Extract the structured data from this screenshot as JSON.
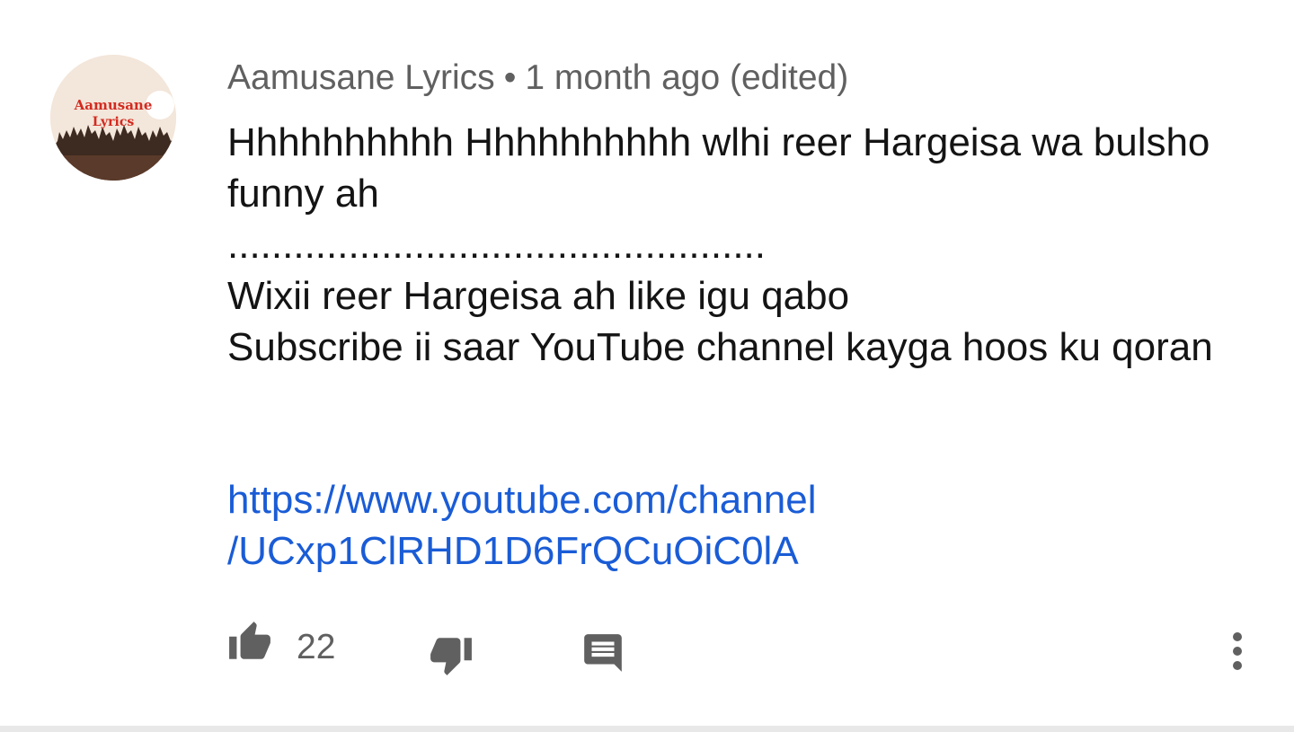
{
  "comment": {
    "avatar": {
      "text_line1": "Aamusane",
      "text_line2": "Lyrics",
      "accent_color": "#d42a1f"
    },
    "author": "Aamusane Lyrics",
    "separator": "•",
    "time": "1 month ago (edited)",
    "body": "Hhhhhhhhhh Hhhhhhhhhh wlhi reer Hargeisa wa bulsho funny ah\n.................................................\nWixii reer Hargeisa ah like igu qabo\nSubscribe ii saar YouTube channel kayga hoos ku qoran",
    "link_line1": "https://www.youtube.com/channel",
    "link_line2": "/UCxp1ClRHD1D6FrQCuOiC0lA",
    "link_color": "#1a5cd6"
  },
  "actions": {
    "like_icon": "thumb-up-icon",
    "like_count": "22",
    "dislike_icon": "thumb-down-icon",
    "reply_icon": "comment-icon",
    "more_icon": "more-vertical-icon"
  }
}
